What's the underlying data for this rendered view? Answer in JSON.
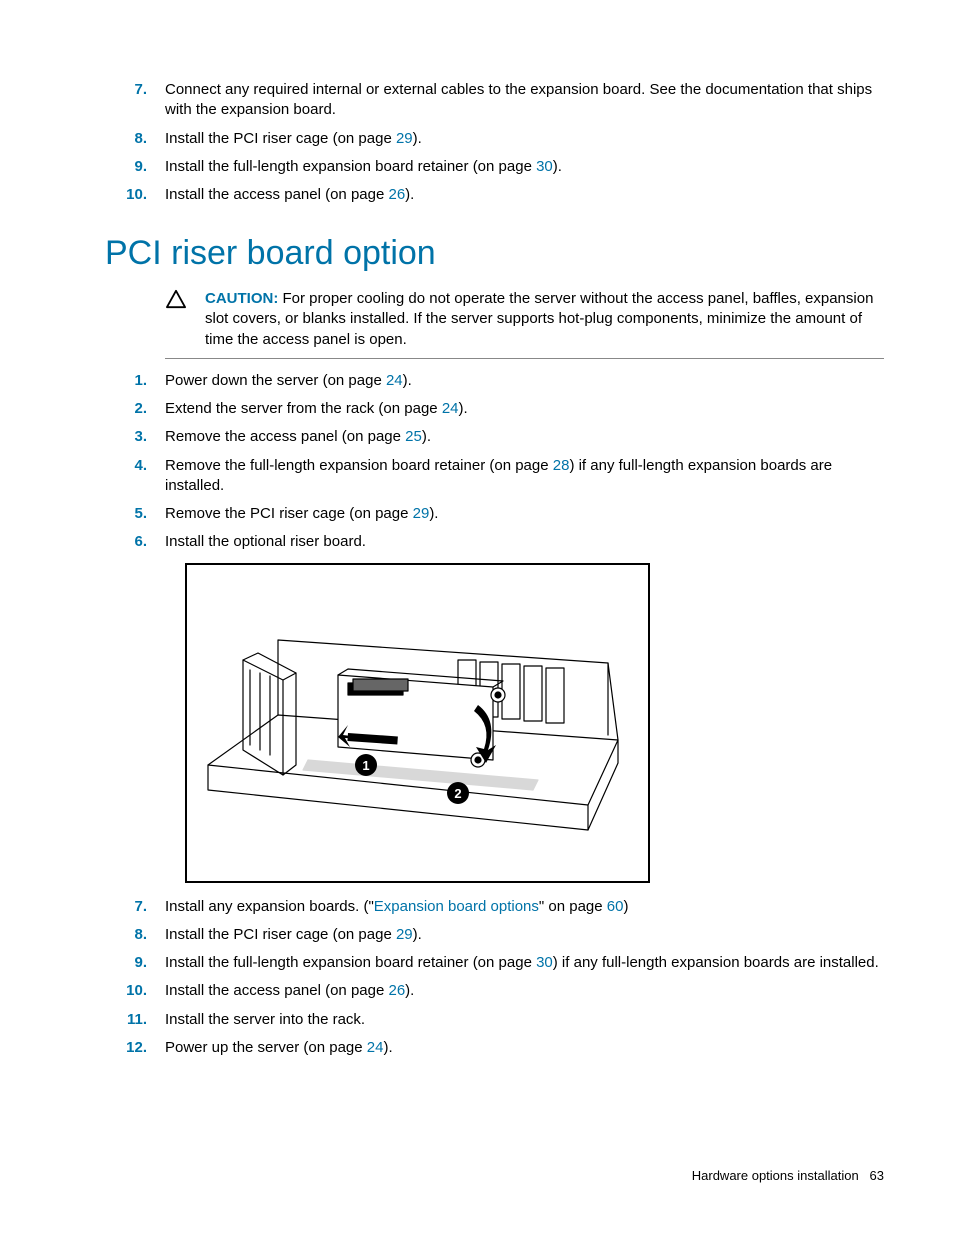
{
  "top_steps": [
    {
      "num": "7.",
      "segments": [
        {
          "t": "Connect any required internal or external cables to the expansion board. See the documentation that ships with the expansion board."
        }
      ]
    },
    {
      "num": "8.",
      "segments": [
        {
          "t": "Install the PCI riser cage (on page "
        },
        {
          "t": "29",
          "link": true
        },
        {
          "t": ")."
        }
      ]
    },
    {
      "num": "9.",
      "segments": [
        {
          "t": "Install the full-length expansion board retainer (on page "
        },
        {
          "t": "30",
          "link": true
        },
        {
          "t": ")."
        }
      ]
    },
    {
      "num": "10.",
      "segments": [
        {
          "t": "Install the access panel (on page "
        },
        {
          "t": "26",
          "link": true
        },
        {
          "t": ")."
        }
      ]
    }
  ],
  "section_title": "PCI riser board option",
  "caution": {
    "label": "CAUTION:",
    "text": " For proper cooling do not operate the server without the access panel, baffles, expansion slot covers, or blanks installed. If the server supports hot-plug components, minimize the amount of time the access panel is open."
  },
  "mid_steps": [
    {
      "num": "1.",
      "segments": [
        {
          "t": "Power down the server (on page "
        },
        {
          "t": "24",
          "link": true
        },
        {
          "t": ")."
        }
      ]
    },
    {
      "num": "2.",
      "segments": [
        {
          "t": "Extend the server from the rack (on page "
        },
        {
          "t": "24",
          "link": true
        },
        {
          "t": ")."
        }
      ]
    },
    {
      "num": "3.",
      "segments": [
        {
          "t": "Remove the access panel (on page "
        },
        {
          "t": "25",
          "link": true
        },
        {
          "t": ")."
        }
      ]
    },
    {
      "num": "4.",
      "segments": [
        {
          "t": "Remove the full-length expansion board retainer (on page "
        },
        {
          "t": "28",
          "link": true
        },
        {
          "t": ") if any full-length expansion boards are installed."
        }
      ]
    },
    {
      "num": "5.",
      "segments": [
        {
          "t": "Remove the PCI riser cage (on page "
        },
        {
          "t": "29",
          "link": true
        },
        {
          "t": ")."
        }
      ]
    },
    {
      "num": "6.",
      "segments": [
        {
          "t": "Install the optional riser board."
        }
      ]
    }
  ],
  "bottom_steps": [
    {
      "num": "7.",
      "segments": [
        {
          "t": "Install any expansion boards. (\""
        },
        {
          "t": "Expansion board options",
          "link": true
        },
        {
          "t": "\" on page "
        },
        {
          "t": "60",
          "link": true
        },
        {
          "t": ")"
        }
      ]
    },
    {
      "num": "8.",
      "segments": [
        {
          "t": "Install the PCI riser cage (on page "
        },
        {
          "t": "29",
          "link": true
        },
        {
          "t": ")."
        }
      ]
    },
    {
      "num": "9.",
      "segments": [
        {
          "t": "Install the full-length expansion board retainer (on page "
        },
        {
          "t": "30",
          "link": true
        },
        {
          "t": ") if any full-length expansion boards are installed."
        }
      ]
    },
    {
      "num": "10.",
      "segments": [
        {
          "t": "Install the access panel (on page "
        },
        {
          "t": "26",
          "link": true
        },
        {
          "t": ")."
        }
      ]
    },
    {
      "num": "11.",
      "segments": [
        {
          "t": "Install the server into the rack."
        }
      ]
    },
    {
      "num": "12.",
      "segments": [
        {
          "t": "Power up the server (on page "
        },
        {
          "t": "24",
          "link": true
        },
        {
          "t": ")."
        }
      ]
    }
  ],
  "diagram": {
    "callout1": "1",
    "callout2": "2"
  },
  "footer": {
    "section": "Hardware options installation",
    "page": "63"
  }
}
